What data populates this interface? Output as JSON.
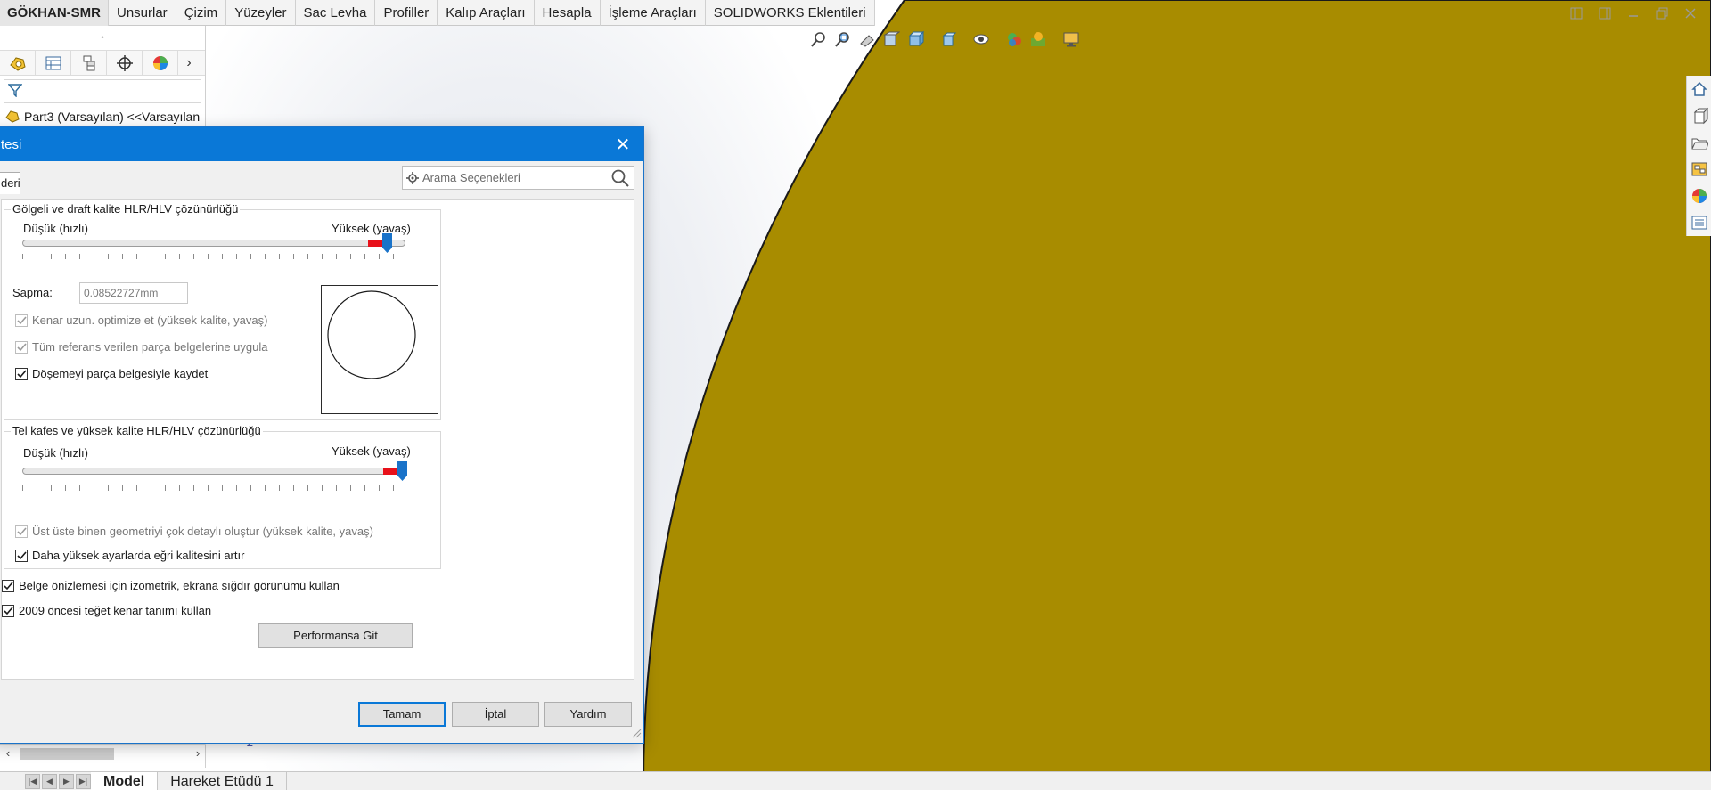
{
  "command_manager": {
    "tabs": [
      "GÖKHAN-SMR",
      "Unsurlar",
      "Çizim",
      "Yüzeyler",
      "Sac Levha",
      "Profiller",
      "Kalıp Araçları",
      "Hesapla",
      "İşleme Araçları",
      "SOLIDWORKS Eklentileri"
    ]
  },
  "heads_up_toolbar": {
    "icons": [
      "zoom-to-fit-icon",
      "zoom-to-area-icon",
      "previous-view-icon",
      "section-view-icon",
      "view-orientation-icon",
      "display-style-icon",
      "hide-show-items-icon",
      "edit-appearance-icon",
      "apply-scene-icon",
      "view-settings-icon"
    ]
  },
  "feature_manager": {
    "tree_root": "Part3 (Varsayılan) <<Varsayılan",
    "tabs": [
      "feature-manager-tab",
      "property-manager-tab",
      "configuration-manager-tab",
      "dimxpert-manager-tab",
      "display-manager-tab"
    ]
  },
  "task_pane": {
    "icons": [
      "solidworks-resources-icon",
      "design-library-icon",
      "file-explorer-icon",
      "view-palette-icon",
      "appearances-scenes-icon",
      "custom-properties-icon"
    ]
  },
  "dialog": {
    "title": "tesi",
    "close_symbol": "✕",
    "tab_label": "deri",
    "search_placeholder": "Arama Seçenekleri",
    "group1": {
      "title": "Gölgeli ve draft kalite HLR/HLV çözünürlüğü",
      "low_label": "Düşük (hızlı)",
      "high_label": "Yüksek (yavaş)",
      "slider_value": 0.95,
      "sapma_label": "Sapma:",
      "sapma_value": "0.08522727mm",
      "cb_optimize": "Kenar uzun. optimize et (yüksek kalite, yavaş)",
      "cb_apply_all": "Tüm referans verilen parça belgelerine uygula",
      "cb_save_tess": "Döşemeyi parça belgesiyle kaydet"
    },
    "group2": {
      "title": "Tel kafes ve yüksek kalite HLR/HLV çözünürlüğü",
      "low_label": "Düşük (hızlı)",
      "high_label": "Yüksek (yavaş)",
      "slider_value": 0.99,
      "cb_overlap": "Üst üste binen geometriyi çok detaylı oluştur (yüksek kalite, yavaş)",
      "cb_curve": "Daha yüksek ayarlarda eğri kalitesini artır"
    },
    "cb_isometric": "Belge önizlemesi için izometrik, ekrana sığdır görünümü kullan",
    "cb_tangent": "2009 öncesi teğet kenar tanımı kullan",
    "performance_button": "Performansa Git",
    "ok_button": "Tamam",
    "cancel_button": "İptal",
    "help_button": "Yardım"
  },
  "axis_label": "Z",
  "bottom_tabs": {
    "model": "Model",
    "motion": "Hareket Etüdü 1"
  },
  "colors": {
    "part_face": "#a88c00",
    "dialog_title_bar": "#0a78d7",
    "slider_fill": "#e8101a",
    "slider_thumb": "#1a73c9"
  }
}
